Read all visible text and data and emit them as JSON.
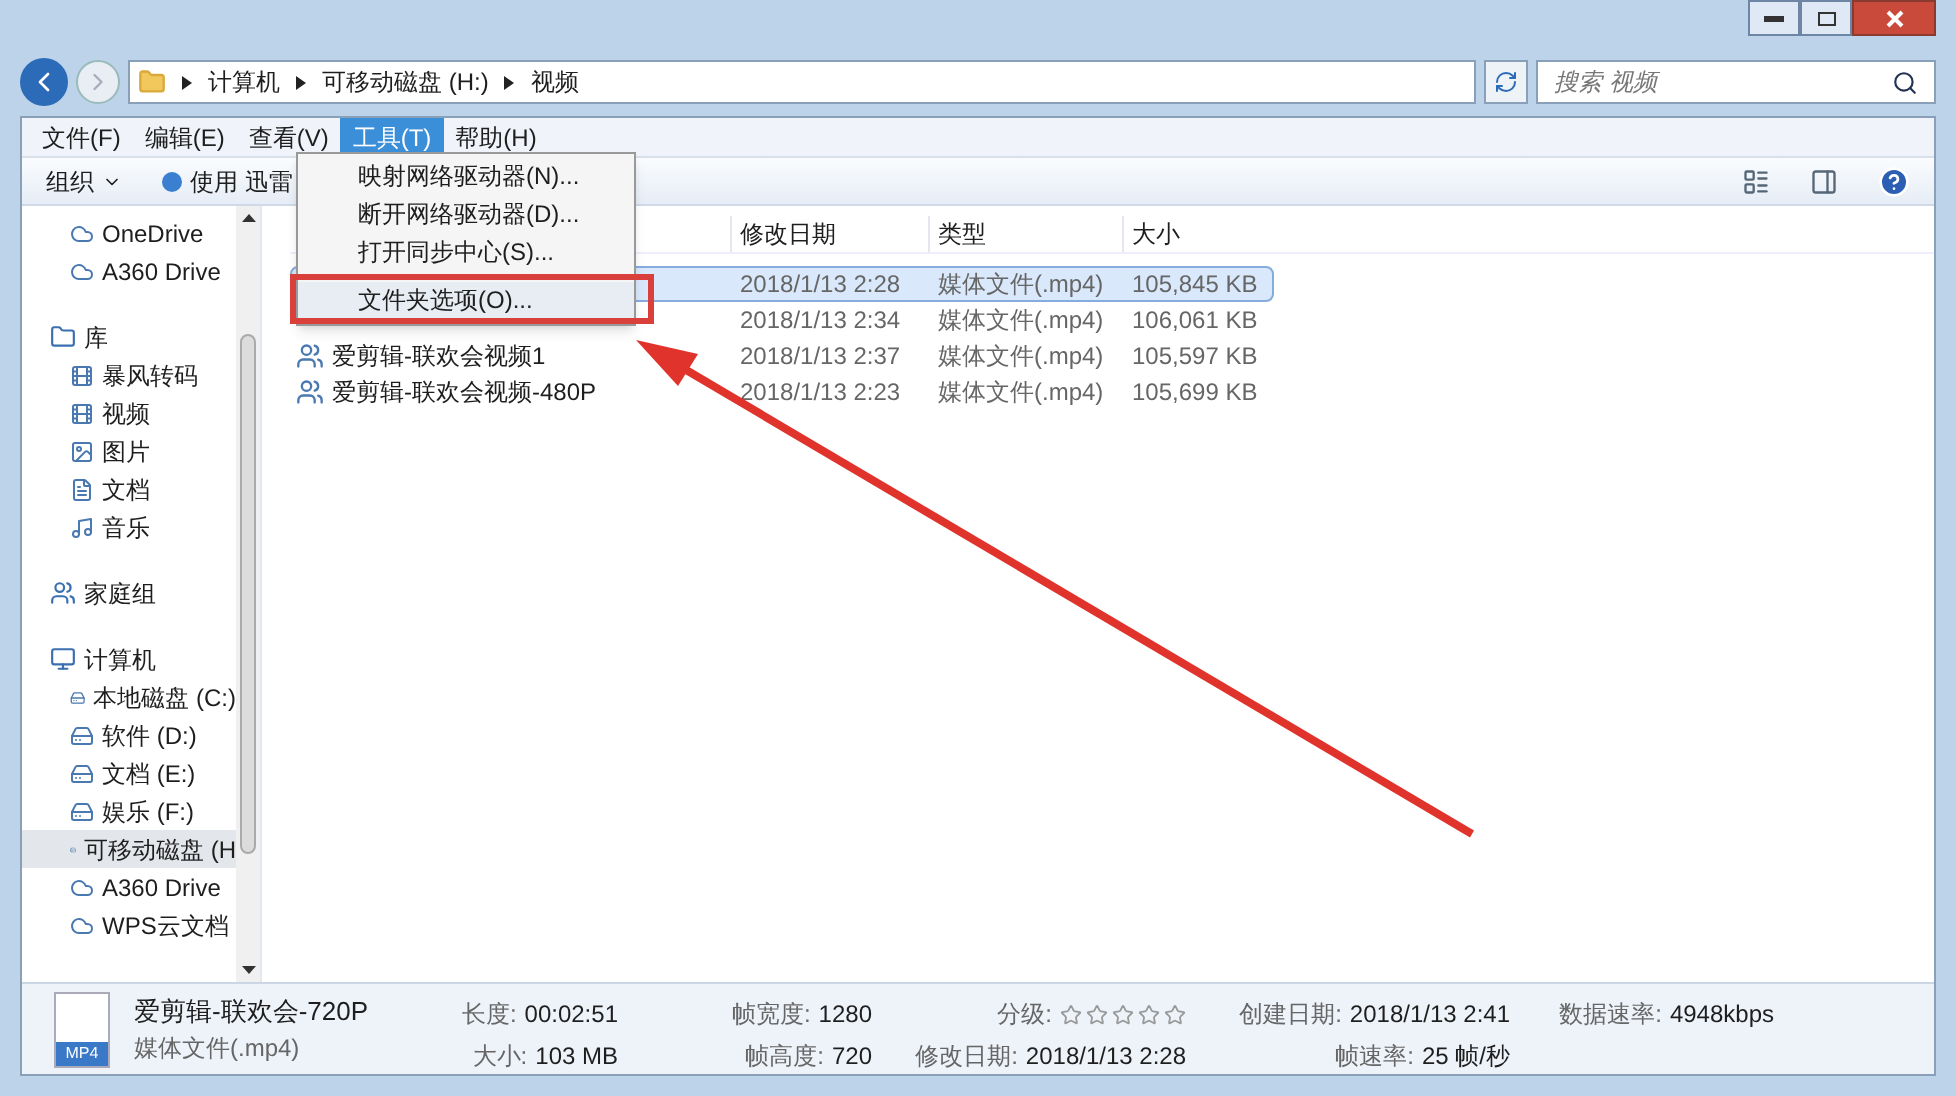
{
  "address": {
    "crumbs": [
      "计算机",
      "可移动磁盘 (H:)",
      "视频"
    ]
  },
  "search": {
    "placeholder": "搜索 视频"
  },
  "menubar": [
    {
      "label": "文件(F)",
      "selected": false
    },
    {
      "label": "编辑(E)",
      "selected": false
    },
    {
      "label": "查看(V)",
      "selected": false
    },
    {
      "label": "工具(T)",
      "selected": true
    },
    {
      "label": "帮助(H)",
      "selected": false
    }
  ],
  "menu": [
    {
      "label": "映射网络驱动器(N)...",
      "highlighted": false
    },
    {
      "label": "断开网络驱动器(D)...",
      "highlighted": false
    },
    {
      "label": "打开同步中心(S)...",
      "highlighted": false
    },
    {
      "label": "文件夹选项(O)...",
      "highlighted": true
    }
  ],
  "toolbar": {
    "organize": "组织",
    "play": "使用 迅雷"
  },
  "nav": [
    {
      "children": [
        {
          "label": "OneDrive",
          "selected": false
        },
        {
          "label": "A360 Drive",
          "selected": false
        }
      ]
    },
    {
      "label": "库",
      "children": [
        {
          "label": "暴风转码",
          "selected": false
        },
        {
          "label": "视频",
          "selected": false
        },
        {
          "label": "图片",
          "selected": false
        },
        {
          "label": "文档",
          "selected": false
        },
        {
          "label": "音乐",
          "selected": false
        }
      ]
    },
    {
      "label": "家庭组"
    },
    {
      "label": "计算机",
      "children": [
        {
          "label": "本地磁盘 (C:)",
          "selected": false
        },
        {
          "label": "软件 (D:)",
          "selected": false
        },
        {
          "label": "文档 (E:)",
          "selected": false
        },
        {
          "label": "娱乐 (F:)",
          "selected": false
        },
        {
          "label": "可移动磁盘 (H",
          "selected": true
        },
        {
          "label": "A360 Drive",
          "selected": false
        },
        {
          "label": "WPS云文档",
          "selected": false
        }
      ]
    }
  ],
  "table": {
    "columns": [
      "修改日期",
      "类型",
      "大小"
    ],
    "rows": [
      {
        "date": "2018/1/13 2:28",
        "type": "媒体文件(.mp4)",
        "size": "105,845 KB",
        "selected": true
      },
      {
        "date": "2018/1/13 2:34",
        "type": "媒体文件(.mp4)",
        "size": "106,061 KB",
        "selected": false
      },
      {
        "name": "爱剪辑-联欢会视频1",
        "date": "2018/1/13 2:37",
        "type": "媒体文件(.mp4)",
        "size": "105,597 KB",
        "selected": false
      },
      {
        "name": "爱剪辑-联欢会视频-480P",
        "date": "2018/1/13 2:23",
        "type": "媒体文件(.mp4)",
        "size": "105,699 KB",
        "selected": false
      }
    ]
  },
  "details": {
    "badge": "MP4",
    "name": "爱剪辑-联欢会-720P",
    "kind": "媒体文件(.mp4)",
    "stars": 0,
    "fields": [
      [
        {
          "label": "长度:",
          "value": "00:02:51"
        },
        {
          "label": "大小:",
          "value": "103 MB"
        }
      ],
      [
        {
          "label": "帧宽度:",
          "value": "1280"
        },
        {
          "label": "帧高度:",
          "value": "720"
        }
      ],
      [
        {
          "label": "分级:",
          "kind": "rating"
        },
        {
          "label": "修改日期:",
          "value": "2018/1/13 2:28"
        }
      ],
      [
        {
          "label": "创建日期:",
          "value": "2018/1/13 2:41"
        },
        {
          "label": "帧速率:",
          "value": "25 帧/秒"
        }
      ],
      [
        {
          "label": "数据速率:",
          "value": "4948kbps"
        }
      ]
    ]
  }
}
